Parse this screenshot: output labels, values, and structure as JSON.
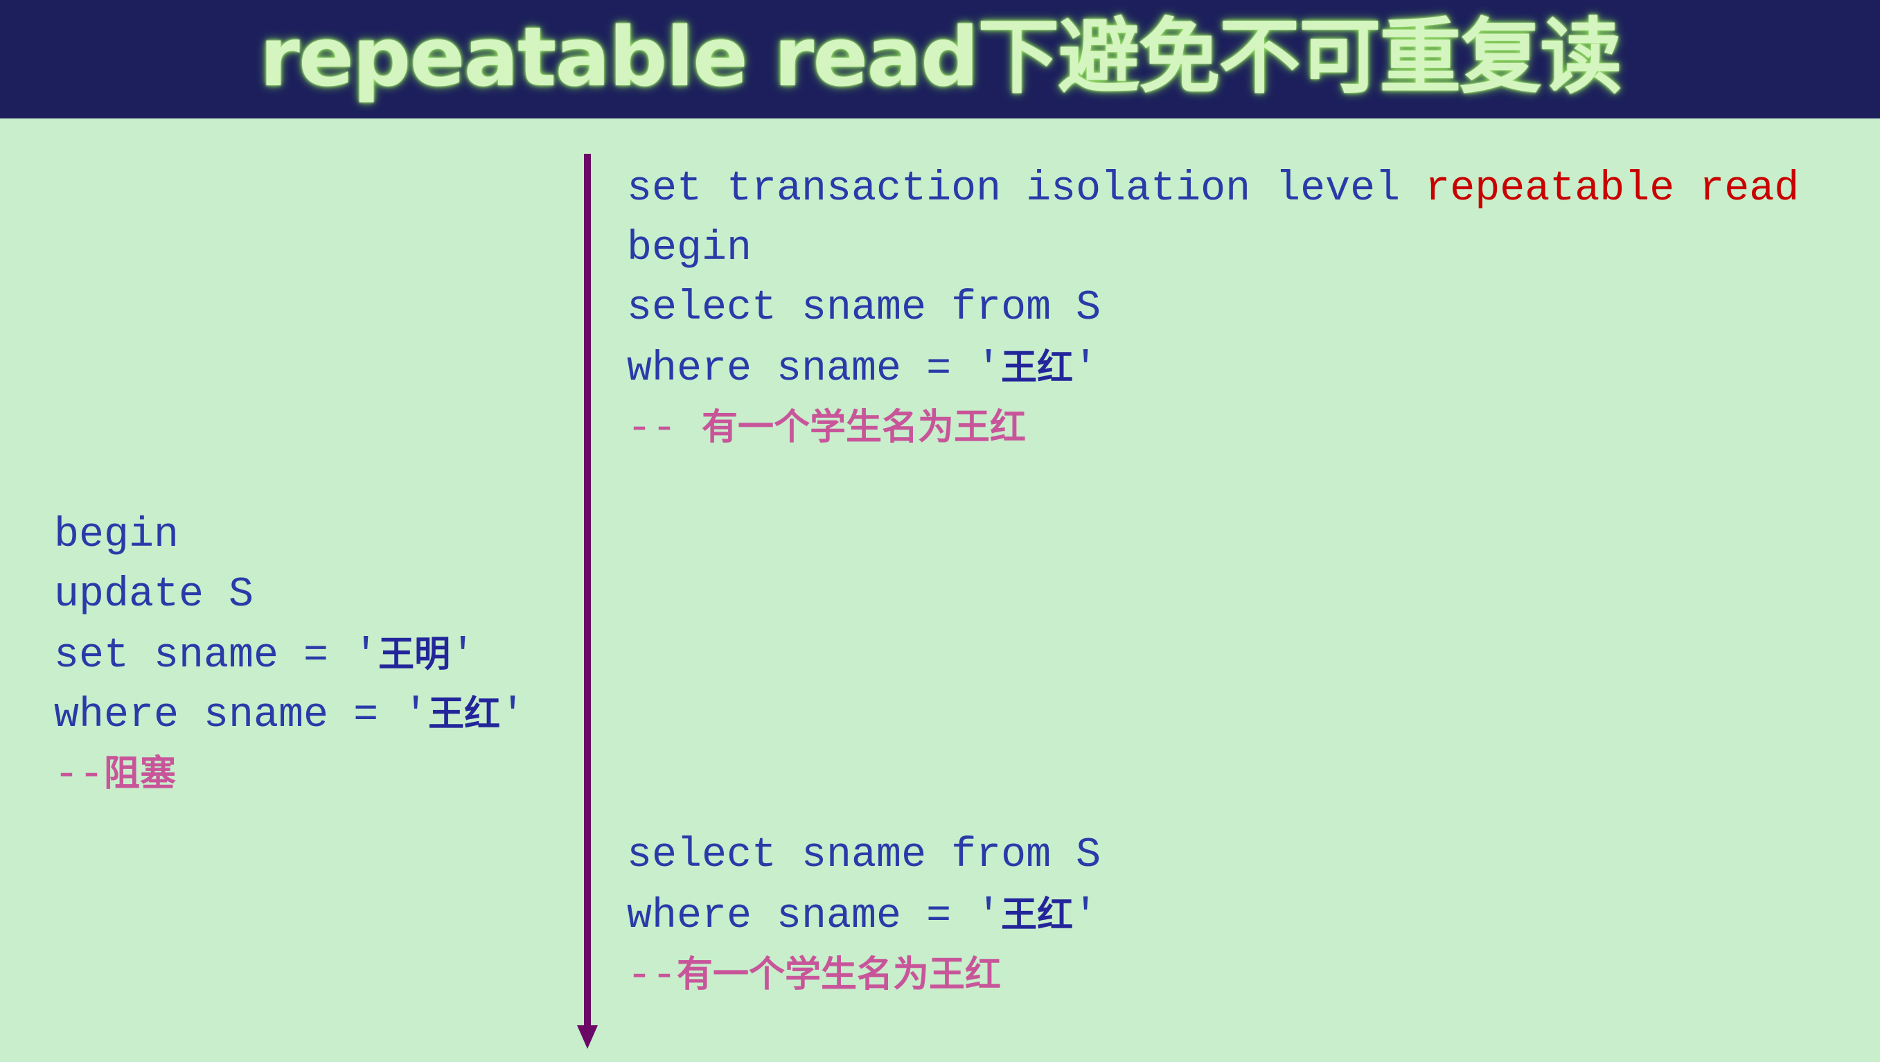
{
  "title": "repeatable read下避免不可重复读",
  "transaction_1_first": {
    "line1_prefix": "set transaction isolation level ",
    "line1_keyword": "repeatable read",
    "line2": "begin",
    "line3": "select sname from S",
    "line4_prefix": "where sname = '",
    "line4_value": "王红",
    "line4_suffix": "'",
    "line5_prefix": "-- ",
    "line5_comment": "有一个学生名为王红"
  },
  "transaction_2": {
    "line1": "begin",
    "line2": "update S",
    "line3_prefix": "set sname = '",
    "line3_value": "王明",
    "line3_suffix": "'",
    "line4_prefix": "where sname = '",
    "line4_value": "王红",
    "line4_suffix": "'",
    "line5_prefix": "--",
    "line5_comment": "阻塞"
  },
  "transaction_1_second": {
    "line1": "select sname from S",
    "line2_prefix": "where sname = '",
    "line2_value": "王红",
    "line2_suffix": "'",
    "line3_prefix": "--",
    "line3_comment": "有一个学生名为王红"
  },
  "colors": {
    "header_bg": "#1c1f5c",
    "page_bg": "#c8eecc",
    "code_text": "#2a3aa8",
    "keyword": "#c80000",
    "comment": "#c8559a",
    "timeline": "#6a0a66"
  }
}
